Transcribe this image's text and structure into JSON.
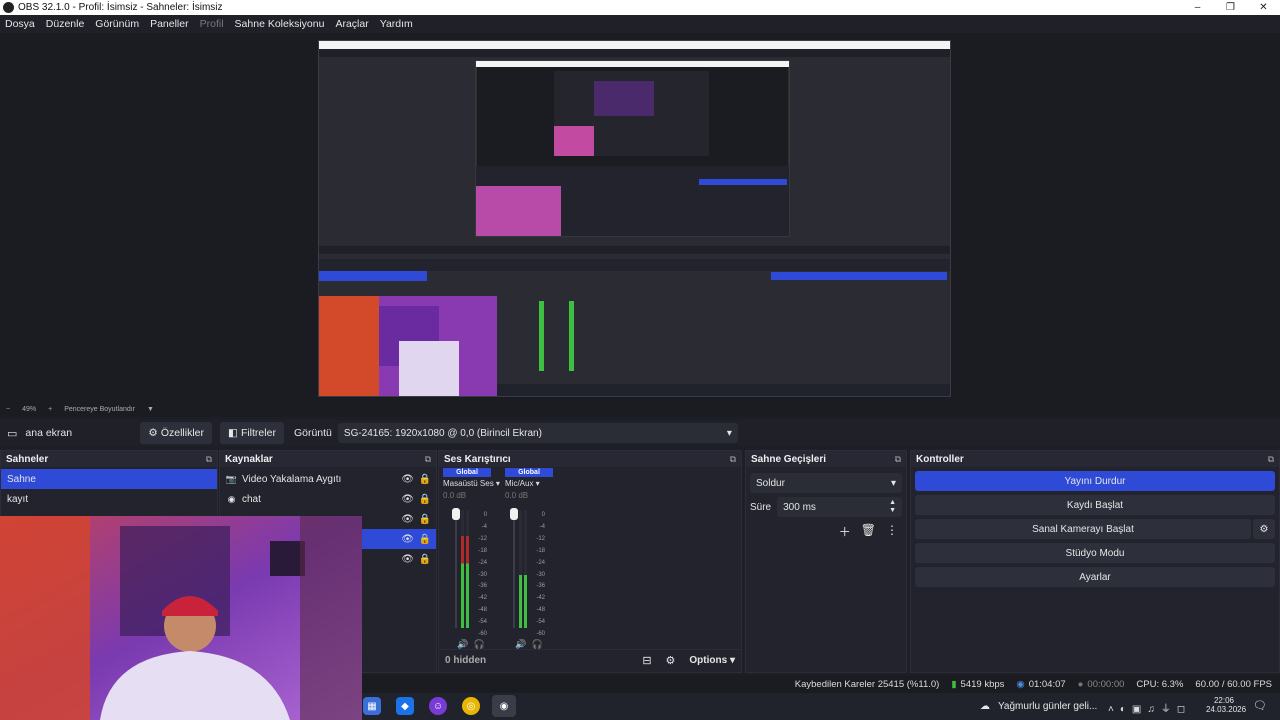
{
  "window": {
    "title": "OBS 32.1.0 - Profil: İsimsiz - Sahneler: İsimsiz",
    "minimize": "–",
    "restore": "❐",
    "close": "✕"
  },
  "menu": {
    "items": [
      "Dosya",
      "Düzenle",
      "Görünüm",
      "Paneller",
      "Profil",
      "Sahne Koleksiyonu",
      "Araçlar",
      "Yardım"
    ]
  },
  "preview": {
    "zoom": "49%",
    "fit_label": "Pencereye Boyutlandır"
  },
  "context_bar": {
    "source_name": "ana ekran",
    "properties_label": "Özellikler",
    "filters_label": "Filtreler",
    "display_label": "Görüntü",
    "display_value": "SG-24165: 1920x1080 @ 0,0 (Birincil Ekran)"
  },
  "scenes": {
    "title": "Sahneler",
    "items": [
      "Sahne",
      "kayıt"
    ]
  },
  "sources": {
    "title": "Kaynaklar",
    "items": [
      "Video Yakalama Aygıtı",
      "chat"
    ]
  },
  "mixer": {
    "title": "Ses Karıştırıcı",
    "global_label": "Global",
    "channels": [
      {
        "name": "Masaüstü Ses",
        "db": "0.0 dB",
        "level": 0.78
      },
      {
        "name": "Mic/Aux",
        "db": "0.0 dB",
        "level": 0.45
      }
    ],
    "scale": [
      "0",
      "-4",
      "-12",
      "-18",
      "-24",
      "-30",
      "-36",
      "-42",
      "-48",
      "-54",
      "-60"
    ],
    "hidden_label": "0 hidden",
    "options_label": "Options"
  },
  "transitions": {
    "title": "Sahne Geçişleri",
    "transition": "Soldur",
    "duration_label": "Süre",
    "duration_value": "300 ms"
  },
  "controls": {
    "title": "Kontroller",
    "buttons": [
      "Yayını Durdur",
      "Kaydı Başlat",
      "Sanal Kamerayı Başlat",
      "Stüdyo Modu",
      "Ayarlar"
    ]
  },
  "status": {
    "dropped": "Kaybedilen Kareler 25415 (%11.0)",
    "bitrate": "5419 kbps",
    "stream_time": "01:04:07",
    "rec_time": "00:00:00",
    "cpu": "CPU: 6.3%",
    "fps": "60.00 / 60.00 FPS"
  },
  "taskbar": {
    "weather": "Yağmurlu günler geli...",
    "time": "22:06",
    "date": "24.03.2026"
  },
  "colors": {
    "accent": "#2e4ad6",
    "meter_green": "#3fbf3f",
    "meter_red": "#b02a2a"
  }
}
